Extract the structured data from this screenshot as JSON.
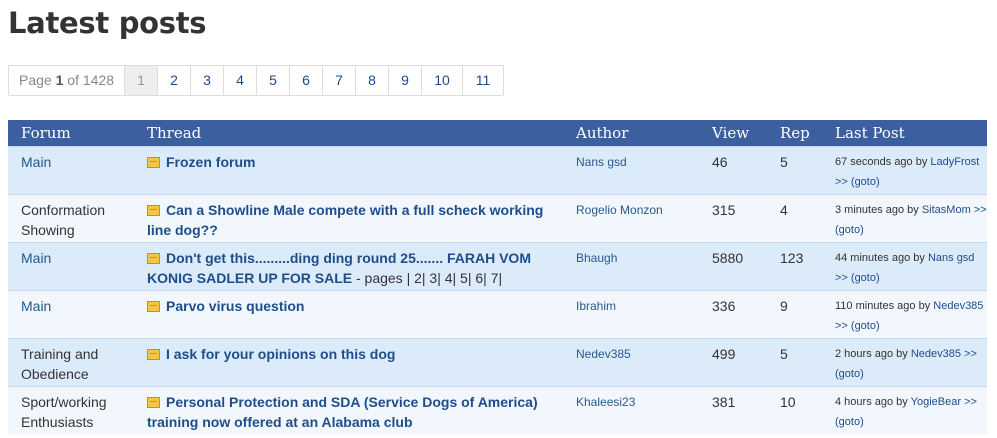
{
  "page_title": "Latest posts",
  "pagination": {
    "info_prefix": "Page",
    "current": "1",
    "info_mid": "of",
    "total": "1428",
    "pages": [
      "1",
      "2",
      "3",
      "4",
      "5",
      "6",
      "7",
      "8",
      "9",
      "10",
      "11"
    ]
  },
  "table": {
    "headers": [
      "Forum",
      "Thread",
      "Author",
      "View",
      "Rep",
      "Last Post"
    ],
    "rows": [
      {
        "forum": "Main",
        "thread": "Frozen forum",
        "thread_pages": "",
        "author": "Nans gsd",
        "views": "46",
        "reps": "5",
        "last_time": "67 seconds ago by",
        "last_user": "LadyFrost",
        "goto": ">> (goto)"
      },
      {
        "forum": "Conformation Showing",
        "thread": "Can a Showline Male compete with a full scheck working line dog??",
        "thread_pages": "",
        "author": "Rogelio Monzon",
        "views": "315",
        "reps": "4",
        "last_time": "3 minutes ago by",
        "last_user": "SitasMom",
        "goto": ">> (goto)"
      },
      {
        "forum": "Main",
        "thread": "Don't get this.........ding ding round 25....... FARAH VOM KONIG SADLER UP FOR SALE",
        "thread_pages": " - pages | 2| 3| 4| 5| 6| 7|",
        "author": "Bhaugh",
        "views": "5880",
        "reps": "123",
        "last_time": "44 minutes ago by",
        "last_user": "Nans gsd",
        "goto": ">> (goto)"
      },
      {
        "forum": "Main",
        "thread": "Parvo virus question",
        "thread_pages": "",
        "author": "Ibrahim",
        "views": "336",
        "reps": "9",
        "last_time": "110 minutes ago by",
        "last_user": "Nedev385",
        "goto": ">> (goto)"
      },
      {
        "forum": "Training and Obedience",
        "thread": "I ask for your opinions on this dog",
        "thread_pages": "",
        "author": "Nedev385",
        "views": "499",
        "reps": "5",
        "last_time": "2 hours ago by",
        "last_user": "Nedev385",
        "goto": ">> (goto)"
      },
      {
        "forum": "Sport/working Enthusiasts",
        "thread": "Personal Protection and SDA (Service Dogs of America) training now offered at an Alabama club",
        "thread_pages": "",
        "author": "Khaleesi23",
        "views": "381",
        "reps": "10",
        "last_time": "4 hours ago by",
        "last_user": "YogieBear",
        "goto": ">> (goto)"
      }
    ]
  }
}
